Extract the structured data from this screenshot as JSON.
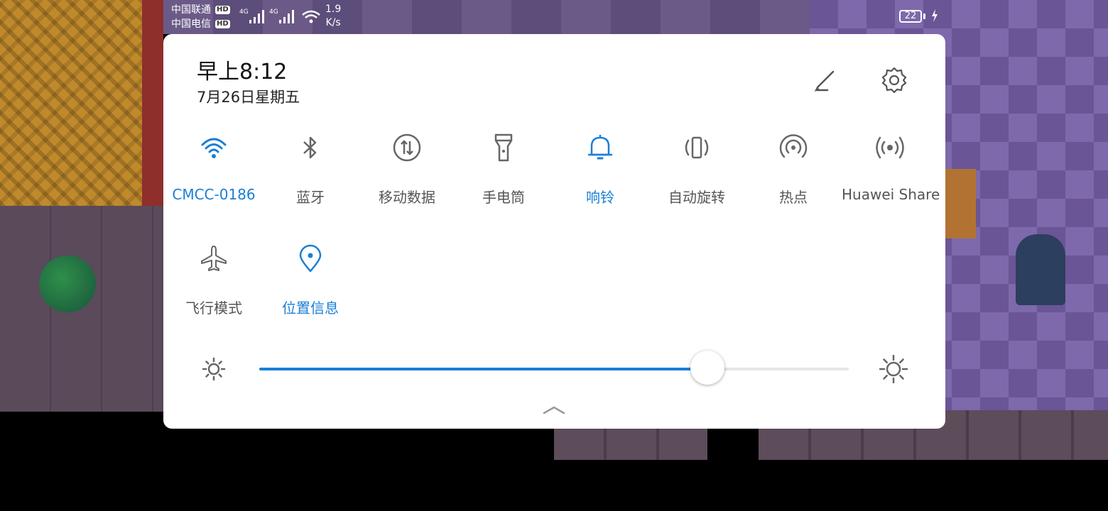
{
  "status_bar": {
    "carrier1": "中国联通",
    "carrier2": "中国电信",
    "hd": "HD",
    "net_type": "4G",
    "speed_value": "1.9",
    "speed_unit": "K/s",
    "battery": "22"
  },
  "header": {
    "time": "早上8:12",
    "date": "7月26日星期五"
  },
  "tiles": [
    {
      "label": "CMCC-0186",
      "active": true,
      "icon": "wifi-icon"
    },
    {
      "label": "蓝牙",
      "active": false,
      "icon": "bluetooth-icon"
    },
    {
      "label": "移动数据",
      "active": false,
      "icon": "mobile-data-icon"
    },
    {
      "label": "手电筒",
      "active": false,
      "icon": "flashlight-icon"
    },
    {
      "label": "响铃",
      "active": true,
      "icon": "bell-icon"
    },
    {
      "label": "自动旋转",
      "active": false,
      "icon": "auto-rotate-icon"
    },
    {
      "label": "热点",
      "active": false,
      "icon": "hotspot-icon"
    },
    {
      "label": "Huawei Share",
      "active": false,
      "icon": "huawei-share-icon"
    },
    {
      "label": "飞行模式",
      "active": false,
      "icon": "airplane-icon"
    },
    {
      "label": "位置信息",
      "active": true,
      "icon": "location-icon"
    }
  ],
  "brightness": {
    "level": 0.76
  },
  "colors": {
    "accent": "#1a7fd6",
    "inactive": "#555555",
    "panel": "#ffffff"
  }
}
